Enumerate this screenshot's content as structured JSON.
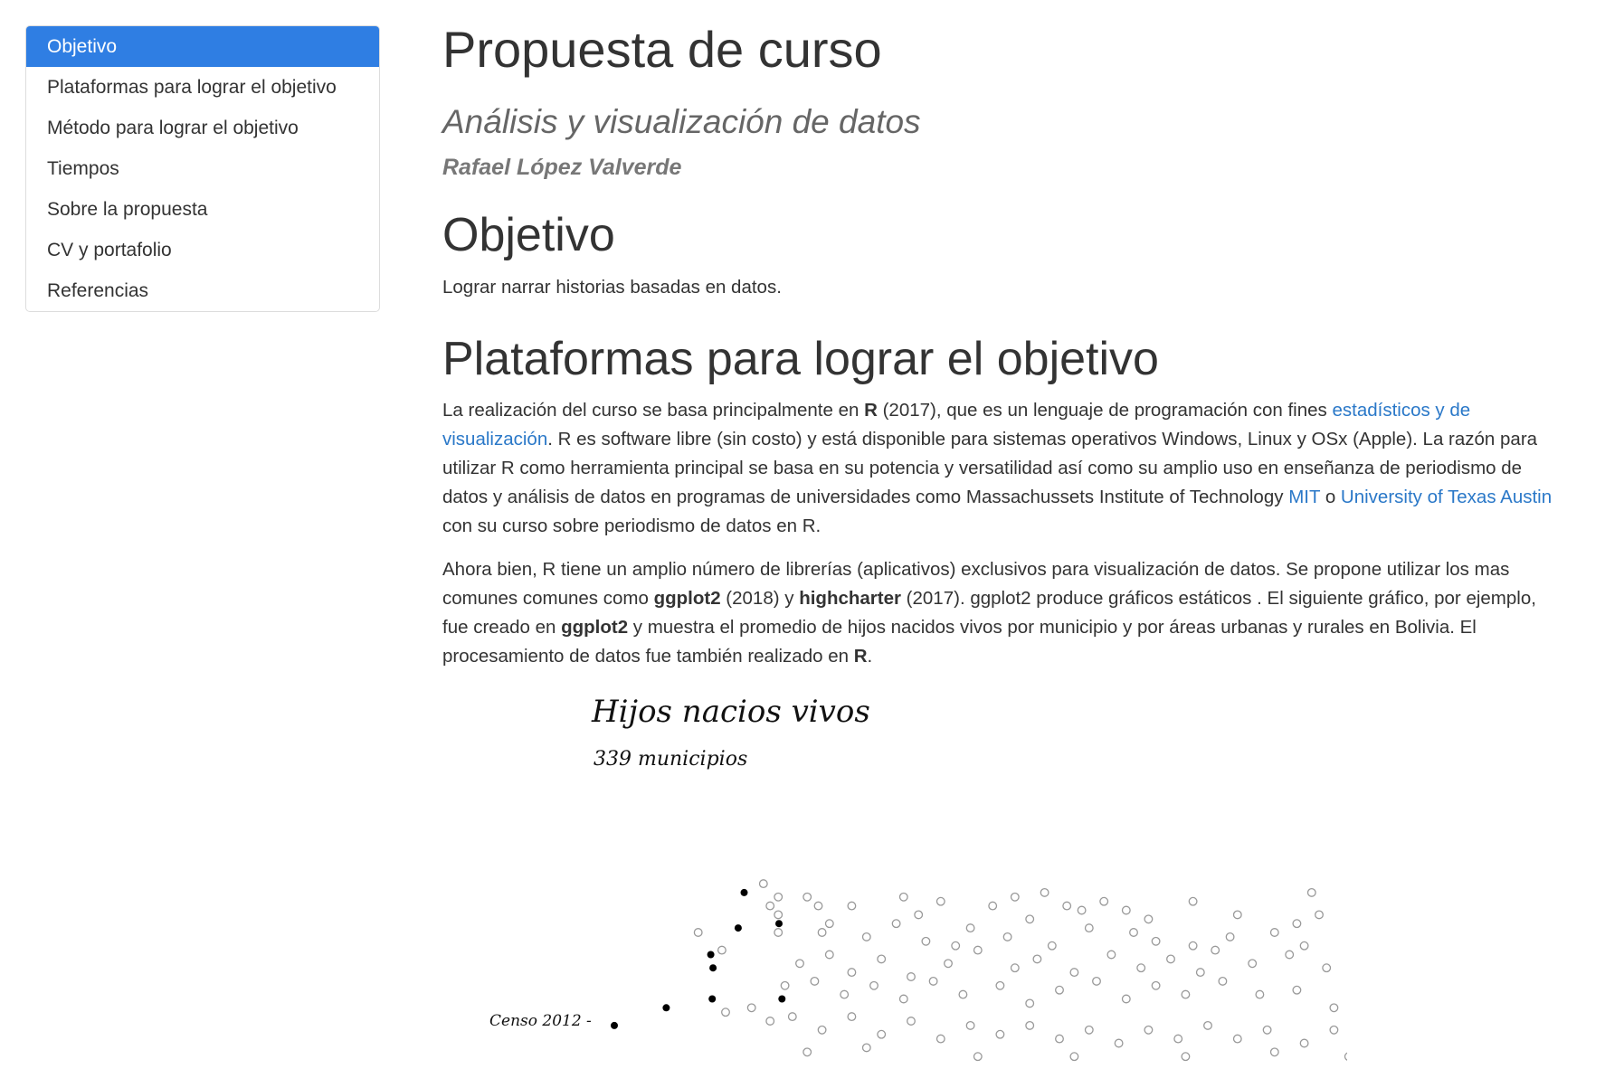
{
  "toc": {
    "items": [
      {
        "label": "Objetivo",
        "active": true
      },
      {
        "label": "Plataformas para lograr el objetivo",
        "active": false
      },
      {
        "label": "Método para lograr el objetivo",
        "active": false
      },
      {
        "label": "Tiempos",
        "active": false
      },
      {
        "label": "Sobre la propuesta",
        "active": false
      },
      {
        "label": "CV y portafolio",
        "active": false
      },
      {
        "label": "Referencias",
        "active": false
      }
    ],
    "active_color": "#2f7ee3"
  },
  "header": {
    "title": "Propuesta de curso",
    "subtitle": "Análisis y visualización de datos",
    "author": "Rafael López Valverde"
  },
  "objetivo": {
    "heading": "Objetivo",
    "text": "Lograr narrar historias basadas en datos."
  },
  "plataformas": {
    "heading": "Plataformas para lograr el objetivo",
    "p1": {
      "t1": "La realización del curso se basa principalmente en ",
      "r": "R",
      "t2": " (2017), que es un lenguaje de programación con fines ",
      "link1": "estadísticos y de visualización",
      "t3": ". R es software libre (sin costo) y está disponible para sistemas operativos Windows, Linux y OSx (Apple). La razón para utilizar R como herramienta principal se basa en su potencia y versatilidad así como su amplio uso en enseñanza de periodismo de datos y análisis de datos en programas de universidades como Massachussets Institute of Technology ",
      "link2": "MIT",
      "t4": " o ",
      "link3": "University of Texas Austin",
      "t5": " con su curso sobre periodismo de datos en R."
    },
    "p2": {
      "t1": "Ahora bien, R tiene un amplio número de librerías (aplicativos) exclusivos para visualización de datos. Se propone utilizar los mas comunes comunes como ",
      "b1": "ggplot2",
      "t2": " (2018) y ",
      "b2": "highcharter",
      "t3": " (2017). ggplot2 produce gráficos estáticos . El siguiente gráfico, por ejemplo, fue creado en ",
      "b3": "ggplot2",
      "t4": " y muestra el promedio de hijos nacidos vivos por municipio y por áreas urbanas y rurales en Bolivia. El procesamiento de datos fue también realizado en ",
      "b4": "R",
      "t5": "."
    },
    "link_color": "#2a78c8"
  },
  "chart_data": {
    "type": "scatter",
    "title": "Hijos nacios vivos",
    "subtitle": "339 municipios",
    "row_label": "Censo 2012 -",
    "series": [
      {
        "marker": "filled",
        "color": "#000000",
        "points": [
          [
            7.45,
            0.95
          ],
          [
            7.92,
            0.6
          ],
          [
            7.37,
            0.55
          ],
          [
            7.0,
            0.25
          ],
          [
            7.03,
            0.1
          ],
          [
            6.4,
            -0.35
          ],
          [
            7.02,
            -0.25
          ],
          [
            7.96,
            -0.25
          ],
          [
            5.7,
            -0.55
          ]
        ]
      },
      {
        "marker": "hollow",
        "color": "#999999",
        "points": [
          [
            6.83,
            0.5
          ],
          [
            7.15,
            0.3
          ],
          [
            7.71,
            1.05
          ],
          [
            7.91,
            0.9
          ],
          [
            7.8,
            0.8
          ],
          [
            7.91,
            0.7
          ],
          [
            7.91,
            0.5
          ],
          [
            8.3,
            0.9
          ],
          [
            8.45,
            0.8
          ],
          [
            8.9,
            0.8
          ],
          [
            9.6,
            0.9
          ],
          [
            10.1,
            0.85
          ],
          [
            10.8,
            0.8
          ],
          [
            11.1,
            0.9
          ],
          [
            11.5,
            0.95
          ],
          [
            12.0,
            0.75
          ],
          [
            12.3,
            0.85
          ],
          [
            12.6,
            0.75
          ],
          [
            13.5,
            0.85
          ],
          [
            14.1,
            0.7
          ],
          [
            15.1,
            0.95
          ],
          [
            16.4,
            0.75
          ],
          [
            16.8,
            0.85
          ],
          [
            15.85,
            0.9
          ],
          [
            15.2,
            0.7
          ],
          [
            8.5,
            0.5
          ],
          [
            8.6,
            0.6
          ],
          [
            9.1,
            0.45
          ],
          [
            9.5,
            0.6
          ],
          [
            9.9,
            0.4
          ],
          [
            10.5,
            0.55
          ],
          [
            11.0,
            0.45
          ],
          [
            11.3,
            0.65
          ],
          [
            11.6,
            0.35
          ],
          [
            12.1,
            0.55
          ],
          [
            12.7,
            0.5
          ],
          [
            13.0,
            0.4
          ],
          [
            13.5,
            0.35
          ],
          [
            14.0,
            0.45
          ],
          [
            14.6,
            0.5
          ],
          [
            15.0,
            0.35
          ],
          [
            15.8,
            0.5
          ],
          [
            16.2,
            0.6
          ],
          [
            16.6,
            0.4
          ],
          [
            17.6,
            0.8
          ],
          [
            8.2,
            0.15
          ],
          [
            8.6,
            0.25
          ],
          [
            8.9,
            0.05
          ],
          [
            9.3,
            0.2
          ],
          [
            9.7,
            0.0
          ],
          [
            10.2,
            0.15
          ],
          [
            10.6,
            0.3
          ],
          [
            11.1,
            0.1
          ],
          [
            11.4,
            0.2
          ],
          [
            11.9,
            0.05
          ],
          [
            12.4,
            0.25
          ],
          [
            12.8,
            0.1
          ],
          [
            13.2,
            0.2
          ],
          [
            13.6,
            0.05
          ],
          [
            14.3,
            0.15
          ],
          [
            14.8,
            0.25
          ],
          [
            15.3,
            0.1
          ],
          [
            15.7,
            0.15
          ],
          [
            16.1,
            0.05
          ],
          [
            17.3,
            0.45
          ],
          [
            17.0,
            0.35
          ],
          [
            16.5,
            0.25
          ],
          [
            8.0,
            -0.1
          ],
          [
            8.4,
            -0.05
          ],
          [
            8.8,
            -0.2
          ],
          [
            9.2,
            -0.1
          ],
          [
            9.6,
            -0.25
          ],
          [
            10.0,
            -0.05
          ],
          [
            10.4,
            -0.2
          ],
          [
            10.9,
            -0.1
          ],
          [
            11.3,
            -0.3
          ],
          [
            11.7,
            -0.15
          ],
          [
            12.2,
            -0.05
          ],
          [
            12.6,
            -0.25
          ],
          [
            13.0,
            -0.1
          ],
          [
            13.4,
            -0.2
          ],
          [
            13.9,
            -0.05
          ],
          [
            14.4,
            -0.2
          ],
          [
            14.9,
            -0.15
          ],
          [
            15.4,
            -0.35
          ],
          [
            15.9,
            -0.3
          ],
          [
            16.5,
            -0.35
          ],
          [
            17.0,
            -0.3
          ],
          [
            7.55,
            -0.35
          ],
          [
            7.8,
            -0.5
          ],
          [
            8.1,
            -0.45
          ],
          [
            8.5,
            -0.6
          ],
          [
            8.9,
            -0.45
          ],
          [
            9.3,
            -0.65
          ],
          [
            9.7,
            -0.5
          ],
          [
            10.1,
            -0.7
          ],
          [
            10.5,
            -0.55
          ],
          [
            10.9,
            -0.65
          ],
          [
            11.3,
            -0.55
          ],
          [
            11.7,
            -0.7
          ],
          [
            12.1,
            -0.6
          ],
          [
            12.5,
            -0.75
          ],
          [
            12.9,
            -0.6
          ],
          [
            13.3,
            -0.7
          ],
          [
            13.7,
            -0.55
          ],
          [
            14.1,
            -0.7
          ],
          [
            14.5,
            -0.6
          ],
          [
            15.0,
            -0.75
          ],
          [
            15.4,
            -0.6
          ],
          [
            15.8,
            -0.7
          ],
          [
            16.2,
            -0.8
          ],
          [
            16.6,
            -0.75
          ],
          [
            8.3,
            -0.85
          ],
          [
            9.1,
            -0.8
          ],
          [
            10.6,
            -0.9
          ],
          [
            11.9,
            -0.9
          ],
          [
            13.4,
            -0.9
          ],
          [
            14.6,
            -0.85
          ],
          [
            15.6,
            -0.9
          ],
          [
            7.2,
            -0.4
          ],
          [
            9.8,
            0.7
          ],
          [
            11.8,
            0.8
          ],
          [
            12.9,
            0.65
          ],
          [
            14.9,
            0.6
          ],
          [
            10.3,
            0.35
          ],
          [
            13.8,
            0.3
          ]
        ]
      }
    ]
  }
}
